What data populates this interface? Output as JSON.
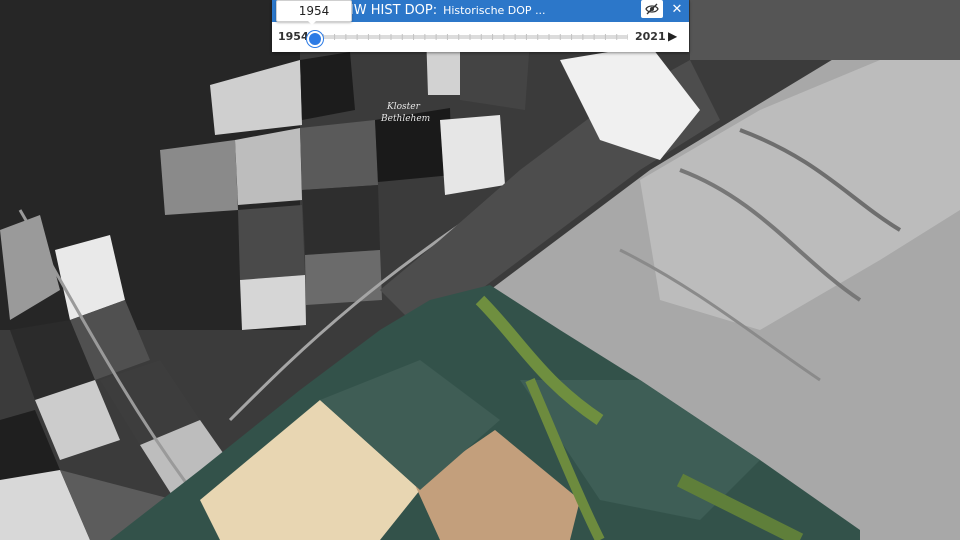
{
  "layer": {
    "title": "NW HIST DOP:",
    "subtitle": "Historische DOP ..."
  },
  "slider": {
    "current_year": "1954",
    "start_year": "1954",
    "end_year": "2021",
    "value_fraction": 0.0
  },
  "map_labels": {
    "place_line1": "Kloster",
    "place_line2": "Bethlehem"
  },
  "icons": {
    "visibility": "eye-off-icon",
    "close": "close-icon",
    "play": "play-icon"
  },
  "colors": {
    "header_blue": "#2c77c9",
    "thumb_blue": "#2c7be5"
  }
}
